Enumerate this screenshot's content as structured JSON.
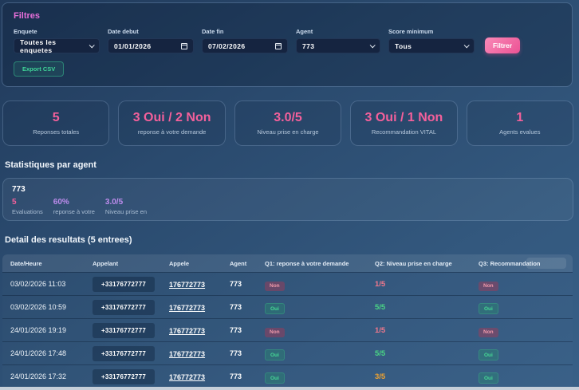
{
  "filters": {
    "title": "Filtres",
    "fields": [
      {
        "label": "Enquete",
        "type": "select",
        "value": "Toutes les enquetes"
      },
      {
        "label": "Date debut",
        "type": "date",
        "value": "01/01/2026"
      },
      {
        "label": "Date fin",
        "type": "date",
        "value": "07/02/2026"
      },
      {
        "label": "Agent",
        "type": "select",
        "value": "773"
      },
      {
        "label": "Score minimum",
        "type": "select",
        "value": "Tous"
      }
    ],
    "filter_button": "Filtrer",
    "export_button": "Export CSV"
  },
  "summary_cards": [
    {
      "value": "5",
      "label": "Reponses totales"
    },
    {
      "value": "3 Oui / 2 Non",
      "label": "reponse à votre demande"
    },
    {
      "value": "3.0/5",
      "label": "Niveau prise en charge"
    },
    {
      "value": "3 Oui / 1 Non",
      "label": "Recommandation VITAL"
    },
    {
      "value": "1",
      "label": "Agents evalues"
    }
  ],
  "agent_section": {
    "title": "Statistiques par agent",
    "agent_id": "773",
    "stats": [
      {
        "value": "5",
        "label": "Evaluations",
        "color": "pink"
      },
      {
        "value": "60%",
        "label": "reponse à votre",
        "color": "purple"
      },
      {
        "value": "3.0/5",
        "label": "Niveau prise en",
        "color": "purple"
      }
    ]
  },
  "results": {
    "title": "Detail des resultats (5 entrees)",
    "columns": [
      "Date/Heure",
      "Appelant",
      "Appele",
      "Agent",
      "Q1: reponse à votre demande",
      "Q2: Niveau prise en charge",
      "Q3: Recommandation"
    ],
    "rows": [
      {
        "datetime": "03/02/2026 11:03",
        "caller": "+33176772777",
        "callee": "176772773",
        "agent": "773",
        "q1": "Non",
        "q2": "1/5",
        "q3": "Non"
      },
      {
        "datetime": "03/02/2026 10:59",
        "caller": "+33176772777",
        "callee": "176772773",
        "agent": "773",
        "q1": "Oui",
        "q2": "5/5",
        "q3": "Oui"
      },
      {
        "datetime": "24/01/2026 19:19",
        "caller": "+33176772777",
        "callee": "176772773",
        "agent": "773",
        "q1": "Non",
        "q2": "1/5",
        "q3": "Non"
      },
      {
        "datetime": "24/01/2026 17:48",
        "caller": "+33176772777",
        "callee": "176772773",
        "agent": "773",
        "q1": "Oui",
        "q2": "5/5",
        "q3": "Oui"
      },
      {
        "datetime": "24/01/2026 17:32",
        "caller": "+33176772777",
        "callee": "176772773",
        "agent": "773",
        "q1": "Oui",
        "q2": "3/5",
        "q3": "Oui"
      }
    ]
  },
  "colors": {
    "title-pink": "#e66fd9",
    "accent-pink": "#f4609b",
    "accent-purple": "#bd8ced",
    "green": "#45d894",
    "red": "#f09aaa",
    "orange": "#f0a32f",
    "export-green": "#3fd598",
    "btn-pink-1": "#f98ab8",
    "btn-pink-2": "#ec5294"
  }
}
